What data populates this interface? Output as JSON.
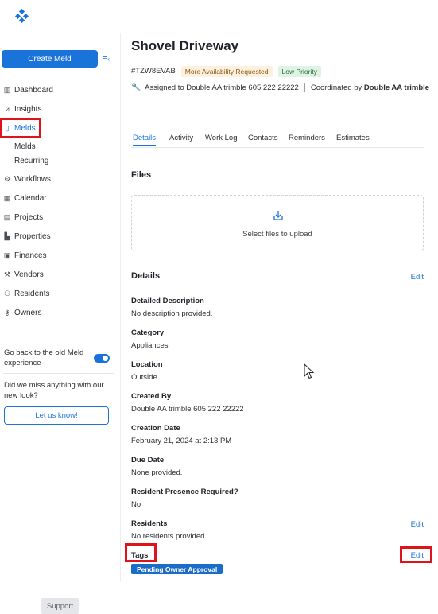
{
  "header": {
    "logo_icon": "meld-logo-icon"
  },
  "sidebar": {
    "create_label": "Create Meld",
    "items": [
      {
        "key": "dashboard",
        "label": "Dashboard",
        "icon": "dashboard-icon"
      },
      {
        "key": "insights",
        "label": "Insights",
        "icon": "insights-icon"
      },
      {
        "key": "melds",
        "label": "Melds",
        "icon": "melds-icon"
      },
      {
        "key": "workflows",
        "label": "Workflows",
        "icon": "workflows-icon"
      },
      {
        "key": "calendar",
        "label": "Calendar",
        "icon": "calendar-icon"
      },
      {
        "key": "projects",
        "label": "Projects",
        "icon": "projects-icon"
      },
      {
        "key": "properties",
        "label": "Properties",
        "icon": "properties-icon"
      },
      {
        "key": "finances",
        "label": "Finances",
        "icon": "finances-icon"
      },
      {
        "key": "vendors",
        "label": "Vendors",
        "icon": "vendors-icon"
      },
      {
        "key": "residents",
        "label": "Residents",
        "icon": "residents-icon"
      },
      {
        "key": "owners",
        "label": "Owners",
        "icon": "owners-icon"
      }
    ],
    "sub_items": [
      "Melds",
      "Recurring"
    ],
    "toggle_text": "Go back to the old Meld experience",
    "miss_text": "Did we miss anything with our new look?",
    "letus_label": "Let us know!",
    "support_label": "Support"
  },
  "meld": {
    "title": "Shovel Driveway",
    "ref": "#TZW8EVAB",
    "badge_availability": "More Availability Requested",
    "badge_priority": "Low Priority",
    "assigned": "Assigned to Double AA trimble 605 222 22222",
    "coordinated_prefix": "Coordinated by",
    "coordinated_name": "Double AA trimble"
  },
  "tabs": [
    "Details",
    "Activity",
    "Work Log",
    "Contacts",
    "Reminders",
    "Estimates"
  ],
  "files": {
    "title": "Files",
    "upload_text": "Select files to upload"
  },
  "details": {
    "title": "Details",
    "edit_label": "Edit",
    "fields": [
      {
        "label": "Detailed Description",
        "value": "No description provided."
      },
      {
        "label": "Category",
        "value": "Appliances"
      },
      {
        "label": "Location",
        "value": "Outside"
      },
      {
        "label": "Created By",
        "value": "Double AA trimble 605 222 22222"
      },
      {
        "label": "Creation Date",
        "value": "February 21, 2024 at 2:13 PM"
      },
      {
        "label": "Due Date",
        "value": "None provided."
      },
      {
        "label": "Resident Presence Required?",
        "value": "No"
      },
      {
        "label": "Residents",
        "value": "No residents provided."
      }
    ],
    "residents_edit": "Edit",
    "tags_label": "Tags",
    "tags_edit": "Edit",
    "tag": "Pending Owner Approval"
  },
  "colors": {
    "accent": "#1a73d9",
    "highlight": "#e0121a"
  }
}
